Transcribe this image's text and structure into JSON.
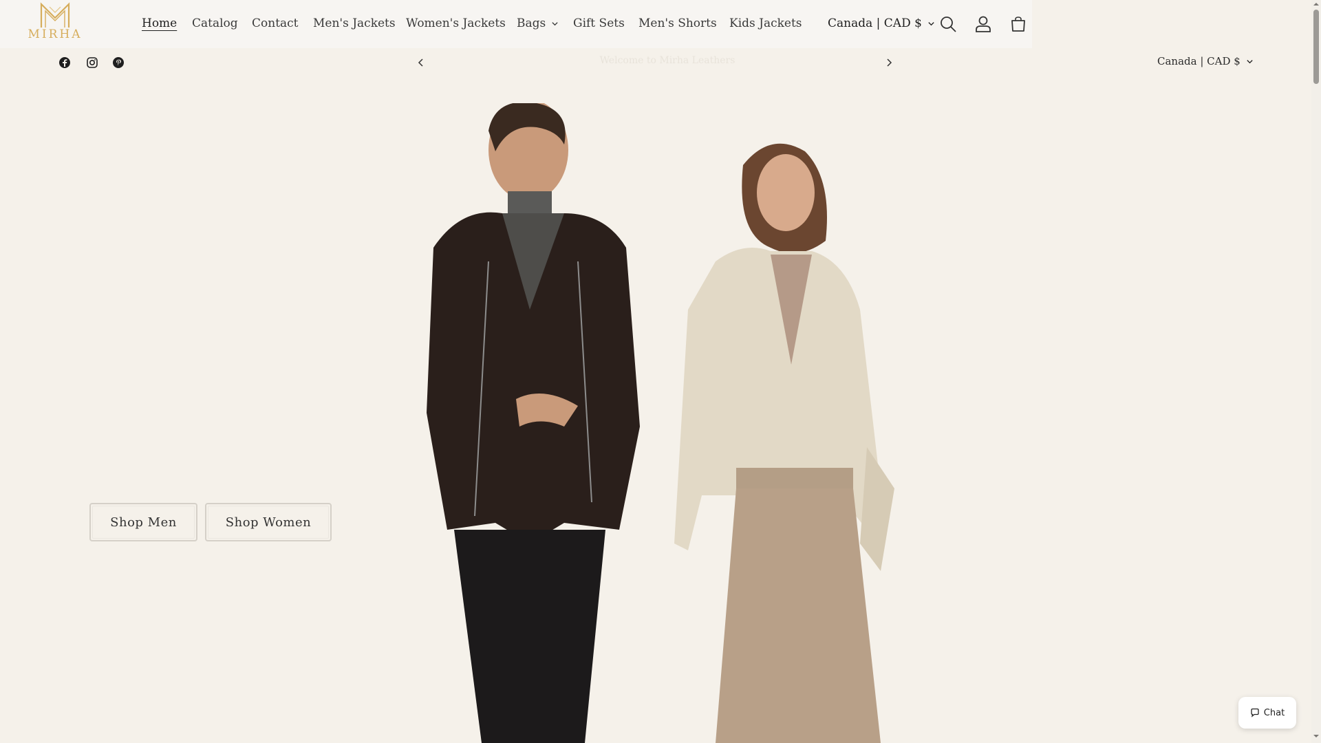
{
  "logo": {
    "text": "MIRHA"
  },
  "nav": {
    "items": [
      {
        "label": "Home",
        "active": true
      },
      {
        "label": "Catalog"
      },
      {
        "label": "Contact"
      },
      {
        "label": "Men's Jackets"
      },
      {
        "label": "Women's Jackets"
      },
      {
        "label": "Bags",
        "dropdown": true
      },
      {
        "label": "Gift Sets"
      },
      {
        "label": "Men's Shorts"
      },
      {
        "label": "Kids Jackets"
      }
    ]
  },
  "header": {
    "country_selector": "Canada | CAD $",
    "icons": [
      "search-icon",
      "account-icon",
      "cart-icon"
    ]
  },
  "announcement": {
    "text": "Welcome to Mirha Leathers",
    "country_selector": "Canada | CAD $",
    "social": [
      "facebook-icon",
      "instagram-icon",
      "pinterest-icon"
    ]
  },
  "hero": {
    "buttons": {
      "men": "Shop Men",
      "women": "Shop Women"
    }
  },
  "chat": {
    "label": "Chat"
  },
  "colors": {
    "background": "#f5f1ea",
    "logo_gold": "#d6ad5c",
    "text": "#2b2b2b"
  }
}
